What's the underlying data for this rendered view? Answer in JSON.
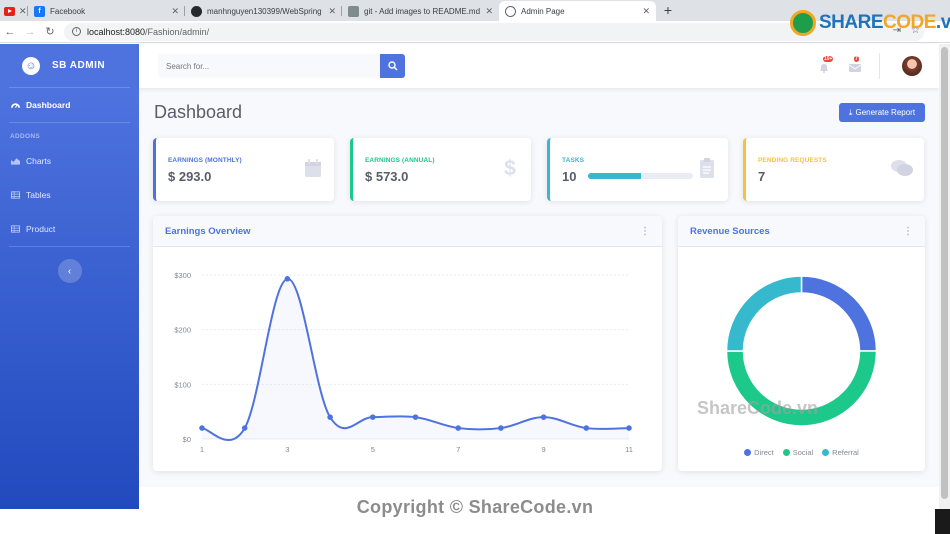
{
  "browser": {
    "tabs": [
      {
        "title": ""
      },
      {
        "title": "Facebook"
      },
      {
        "title": "manhnguyen130399/WebSpring"
      },
      {
        "title": "git - Add images to README.md"
      },
      {
        "title": "Admin Page"
      }
    ],
    "new_tab": "+",
    "url_host": "localhost:8080",
    "url_path": "/Fashion/admin/"
  },
  "sidebar": {
    "brand": "SB ADMIN",
    "dashboard": "Dashboard",
    "heading": "ADDONS",
    "items": [
      {
        "label": "Charts"
      },
      {
        "label": "Tables"
      },
      {
        "label": "Product"
      }
    ]
  },
  "topbar": {
    "search_placeholder": "Search for...",
    "alerts_badge": "10+",
    "messages_badge": "7"
  },
  "page": {
    "title": "Dashboard",
    "generate_report": "Generate Report"
  },
  "stats": [
    {
      "label": "EARNINGS (MONTHLY)",
      "value": "$ 293.0",
      "color": "#4e73df",
      "icon": "calendar-icon"
    },
    {
      "label": "EARNINGS (ANNUAL)",
      "value": "$ 573.0",
      "color": "#1cc88a",
      "icon": "dollar-icon"
    },
    {
      "label": "TASKS",
      "value": "10",
      "color": "#36b9cc",
      "icon": "clipboard-icon",
      "progress": 0.5
    },
    {
      "label": "PENDING REQUESTS",
      "value": "7",
      "color": "#f6c23e",
      "icon": "comments-icon"
    }
  ],
  "panels": {
    "earnings": "Earnings Overview",
    "revenue": "Revenue Sources"
  },
  "chart_data": [
    {
      "type": "area",
      "title": "Earnings Overview",
      "x": [
        1,
        2,
        3,
        4,
        5,
        6,
        7,
        8,
        9,
        10,
        11
      ],
      "xticks": [
        "1",
        "3",
        "5",
        "7",
        "9",
        "11"
      ],
      "yticks": [
        "$0",
        "$100",
        "$200",
        "$300"
      ],
      "series": [
        {
          "values": [
            20,
            20,
            293,
            40,
            40,
            40,
            20,
            20,
            40,
            20,
            20
          ]
        }
      ],
      "ylim": [
        0,
        300
      ],
      "color": "#4e73df",
      "grid": true
    },
    {
      "type": "pie",
      "title": "Revenue Sources",
      "donut": true,
      "labels": [
        "Direct",
        "Social",
        "Referral"
      ],
      "values": [
        25,
        50,
        25
      ],
      "colors": [
        "#4e73df",
        "#1cc88a",
        "#36b9cc"
      ]
    }
  ],
  "watermarks": {
    "mid": "ShareCode.vn",
    "bottom": "Copyright © ShareCode.vn"
  }
}
